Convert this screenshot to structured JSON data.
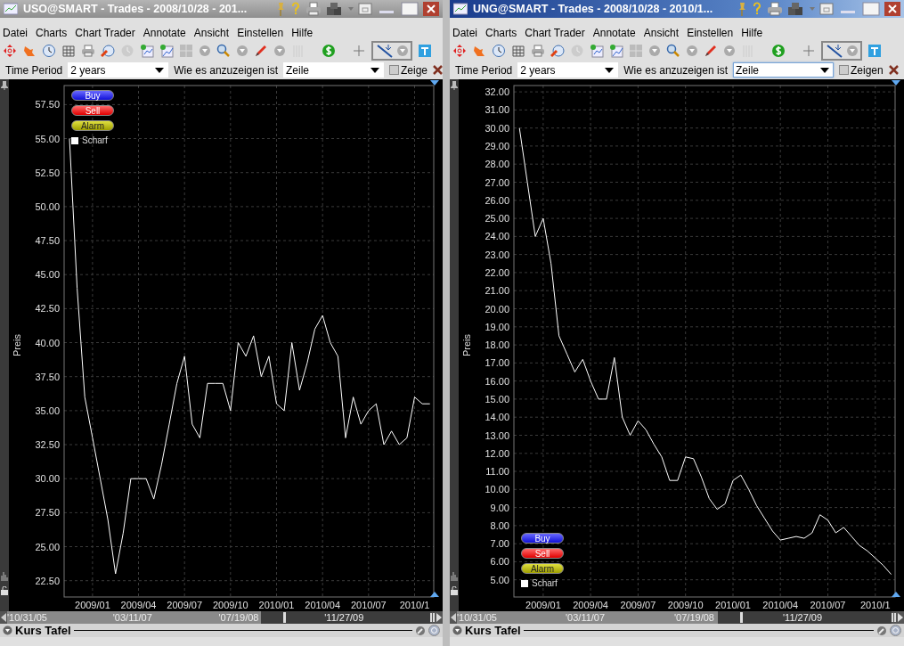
{
  "windows": [
    {
      "title": "USO@SMART - Trades - 2008/10/28 - 201...",
      "active": false,
      "menu": [
        "Datei",
        "Charts",
        "Chart Trader",
        "Annotate",
        "Ansicht",
        "Einstellen",
        "Hilfe"
      ],
      "time_period": {
        "label": "Time Period",
        "value": "2 years"
      },
      "display": {
        "label": "Wie es anzuzeigen ist",
        "value": "Zeile",
        "focused": false
      },
      "show_checkbox": {
        "label": "Zeige",
        "checked": false
      },
      "chart": {
        "legend": {
          "at_bottom": false,
          "buttons": [
            {
              "label": "Buy",
              "kind": "buy"
            },
            {
              "label": "Sell",
              "kind": "sell"
            },
            {
              "label": "Alarm",
              "kind": "alarm"
            }
          ],
          "scharf": {
            "label": "Scharf",
            "checked": false
          }
        },
        "chart_data": {
          "type": "line",
          "ylabel": "Preis",
          "grid": true,
          "ylim": [
            21.3,
            58.9
          ],
          "categories": [
            null,
            null,
            null,
            "2009/01",
            null,
            null,
            null,
            null,
            null,
            "2009/04",
            null,
            null,
            null,
            null,
            null,
            "2009/07",
            null,
            null,
            null,
            null,
            null,
            "2009/10",
            null,
            null,
            null,
            null,
            null,
            "2010/01",
            null,
            null,
            null,
            null,
            null,
            "2010/04",
            null,
            null,
            null,
            null,
            null,
            "2010/07",
            null,
            null,
            null,
            null,
            null,
            "2010/1",
            null,
            null
          ],
          "series": [
            {
              "color": "#ffffff",
              "values": [
                55,
                44,
                36,
                33,
                30,
                27,
                23,
                26,
                30,
                30,
                30,
                28.5,
                31,
                34,
                37,
                39,
                34,
                33,
                37,
                37,
                37,
                35,
                40,
                39,
                40.5,
                37.5,
                39,
                35.5,
                35,
                40,
                36.5,
                38.5,
                41,
                42,
                40,
                39,
                33,
                36,
                34,
                35,
                35.5,
                32.5,
                33.5,
                32.5,
                33,
                36,
                35.5,
                35.5
              ]
            }
          ],
          "yticks": [
            {
              "value": 22.5,
              "label": "22.50"
            },
            {
              "value": 25,
              "label": "25.00"
            },
            {
              "value": 27.5,
              "label": "27.50"
            },
            {
              "value": 30,
              "label": "30.00"
            },
            {
              "value": 32.5,
              "label": "32.50"
            },
            {
              "value": 35,
              "label": "35.00"
            },
            {
              "value": 37.5,
              "label": "37.50"
            },
            {
              "value": 40,
              "label": "40.00"
            },
            {
              "value": 42.5,
              "label": "42.50"
            },
            {
              "value": 45,
              "label": "45.00"
            },
            {
              "value": 47.5,
              "label": "47.50"
            },
            {
              "value": 50,
              "label": "50.00"
            },
            {
              "value": 52.5,
              "label": "52.50"
            },
            {
              "value": 55,
              "label": "55.00"
            },
            {
              "value": 57.5,
              "label": "57.50"
            }
          ]
        }
      },
      "scroller": {
        "labels": [
          "'10/31/05",
          "'03/11/07",
          "'07/19/08",
          "'11/27/09"
        ]
      },
      "panel": {
        "title": "Kurs Tafel"
      }
    },
    {
      "title": "UNG@SMART - Trades - 2008/10/28 - 2010/1...",
      "active": true,
      "menu": [
        "Datei",
        "Charts",
        "Chart Trader",
        "Annotate",
        "Ansicht",
        "Einstellen",
        "Hilfe"
      ],
      "time_period": {
        "label": "Time Period",
        "value": "2 years"
      },
      "display": {
        "label": "Wie es anzuzeigen ist",
        "value": "Zeile",
        "focused": true
      },
      "show_checkbox": {
        "label": "Zeigen",
        "checked": false
      },
      "chart": {
        "legend": {
          "at_bottom": true,
          "buttons": [
            {
              "label": "Buy",
              "kind": "buy"
            },
            {
              "label": "Sell",
              "kind": "sell"
            },
            {
              "label": "Alarm",
              "kind": "alarm"
            }
          ],
          "scharf": {
            "label": "Scharf",
            "checked": false
          }
        },
        "chart_data": {
          "type": "line",
          "ylabel": "Preis",
          "grid": true,
          "ylim": [
            4.05,
            32.35
          ],
          "categories": [
            null,
            null,
            null,
            "2009/01",
            null,
            null,
            null,
            null,
            null,
            "2009/04",
            null,
            null,
            null,
            null,
            null,
            "2009/07",
            null,
            null,
            null,
            null,
            null,
            "2009/10",
            null,
            null,
            null,
            null,
            null,
            "2010/01",
            null,
            null,
            null,
            null,
            null,
            "2010/04",
            null,
            null,
            null,
            null,
            null,
            "2010/07",
            null,
            null,
            null,
            null,
            null,
            "2010/1",
            null,
            null
          ],
          "series": [
            {
              "color": "#ffffff",
              "values": [
                30,
                27,
                24,
                25,
                22.5,
                18.5,
                17.5,
                16.5,
                17.2,
                16,
                15,
                15,
                17.3,
                14,
                13,
                13.8,
                13.3,
                12.5,
                11.8,
                10.5,
                10.5,
                11.8,
                11.7,
                10.7,
                9.5,
                8.9,
                9.2,
                10.5,
                10.8,
                10,
                9.1,
                8.4,
                7.7,
                7.2,
                7.3,
                7.4,
                7.3,
                7.6,
                8.6,
                8.3,
                7.6,
                7.9,
                7.4,
                6.9,
                6.6,
                6.2,
                5.8,
                5.3
              ]
            }
          ],
          "yticks": [
            {
              "value": 5,
              "label": "5.00"
            },
            {
              "value": 6,
              "label": "6.00"
            },
            {
              "value": 7,
              "label": "7.00"
            },
            {
              "value": 8,
              "label": "8.00"
            },
            {
              "value": 9,
              "label": "9.00"
            },
            {
              "value": 10,
              "label": "10.00"
            },
            {
              "value": 11,
              "label": "11.00"
            },
            {
              "value": 12,
              "label": "12.00"
            },
            {
              "value": 13,
              "label": "13.00"
            },
            {
              "value": 14,
              "label": "14.00"
            },
            {
              "value": 15,
              "label": "15.00"
            },
            {
              "value": 16,
              "label": "16.00"
            },
            {
              "value": 17,
              "label": "17.00"
            },
            {
              "value": 18,
              "label": "18.00"
            },
            {
              "value": 19,
              "label": "19.00"
            },
            {
              "value": 20,
              "label": "20.00"
            },
            {
              "value": 21,
              "label": "21.00"
            },
            {
              "value": 22,
              "label": "22.00"
            },
            {
              "value": 23,
              "label": "23.00"
            },
            {
              "value": 24,
              "label": "24.00"
            },
            {
              "value": 25,
              "label": "25.00"
            },
            {
              "value": 26,
              "label": "26.00"
            },
            {
              "value": 27,
              "label": "27.00"
            },
            {
              "value": 28,
              "label": "28.00"
            },
            {
              "value": 29,
              "label": "29.00"
            },
            {
              "value": 30,
              "label": "30.00"
            },
            {
              "value": 31,
              "label": "31.00"
            },
            {
              "value": 32,
              "label": "32.00"
            }
          ]
        }
      },
      "scroller": {
        "labels": [
          "'10/31/05",
          "'03/11/07",
          "'07/19/08",
          "'11/27/09"
        ]
      },
      "panel": {
        "title": "Kurs Tafel"
      }
    }
  ]
}
